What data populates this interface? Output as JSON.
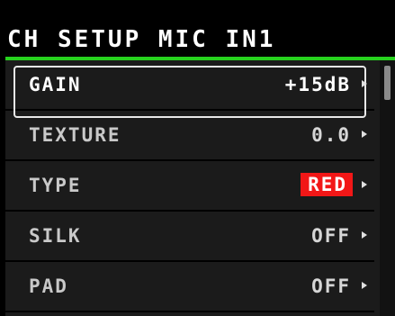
{
  "header": {
    "title": "CH SETUP MIC IN1"
  },
  "colors": {
    "accent": "#27d21e",
    "badge_red": "#f21717"
  },
  "menu": {
    "items": [
      {
        "label": "GAIN",
        "value": "+15dB",
        "selected": true,
        "icon": "chevron-right-icon"
      },
      {
        "label": "TEXTURE",
        "value": "0.0",
        "selected": false,
        "icon": "chevron-right-icon"
      },
      {
        "label": "TYPE",
        "value": "RED",
        "selected": false,
        "icon": "chevron-right-icon"
      },
      {
        "label": "SILK",
        "value": "OFF",
        "selected": false,
        "icon": "chevron-right-icon"
      },
      {
        "label": "PAD",
        "value": "OFF",
        "selected": false,
        "icon": "chevron-right-icon"
      }
    ]
  },
  "scroll": {
    "position_fraction": 0.0
  }
}
